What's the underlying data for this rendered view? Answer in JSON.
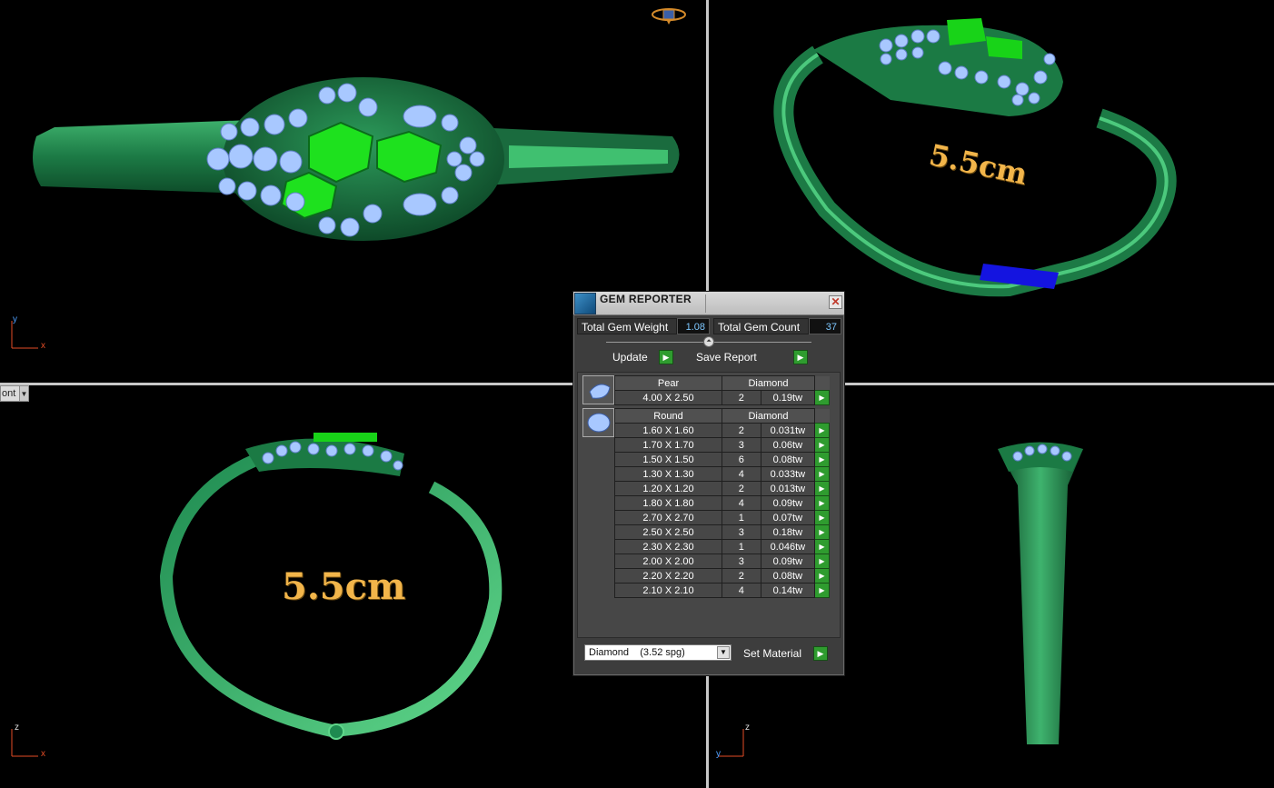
{
  "panel": {
    "title": "GEM REPORTER",
    "close": "✕",
    "total_weight_label": "Total Gem Weight",
    "total_weight_value": "1.08",
    "total_count_label": "Total Gem Count",
    "total_count_value": "37",
    "update_label": "Update",
    "save_report_label": "Save Report",
    "groups": [
      {
        "shape": "Pear",
        "material": "Diamond",
        "rows": [
          {
            "size": "4.00 X 2.50",
            "qty": "2",
            "weight": "0.19tw"
          }
        ]
      },
      {
        "shape": "Round",
        "material": "Diamond",
        "rows": [
          {
            "size": "1.60 X 1.60",
            "qty": "2",
            "weight": "0.031tw"
          },
          {
            "size": "1.70 X 1.70",
            "qty": "3",
            "weight": "0.06tw"
          },
          {
            "size": "1.50 X 1.50",
            "qty": "6",
            "weight": "0.08tw"
          },
          {
            "size": "1.30 X 1.30",
            "qty": "4",
            "weight": "0.033tw"
          },
          {
            "size": "1.20 X 1.20",
            "qty": "2",
            "weight": "0.013tw"
          },
          {
            "size": "1.80 X 1.80",
            "qty": "4",
            "weight": "0.09tw"
          },
          {
            "size": "2.70 X 2.70",
            "qty": "1",
            "weight": "0.07tw"
          },
          {
            "size": "2.50 X 2.50",
            "qty": "3",
            "weight": "0.18tw"
          },
          {
            "size": "2.30 X 2.30",
            "qty": "1",
            "weight": "0.046tw"
          },
          {
            "size": "2.00 X 2.00",
            "qty": "3",
            "weight": "0.09tw"
          },
          {
            "size": "2.20 X 2.20",
            "qty": "2",
            "weight": "0.08tw"
          },
          {
            "size": "2.10 X 2.10",
            "qty": "4",
            "weight": "0.14tw"
          }
        ]
      }
    ],
    "material_select": "Diamond    (3.52 spg)",
    "set_material_label": "Set Material"
  },
  "viewports": {
    "top_right_measure": "5.5cm",
    "bottom_left_measure": "5.5cm",
    "view_dropdown": "ont",
    "axes": {
      "top_left": {
        "v": "y",
        "h": "x"
      },
      "bottom_left": {
        "v": "z",
        "h": "x"
      },
      "bottom_right": {
        "v": "z",
        "h": "y"
      }
    }
  },
  "colors": {
    "band": "#1f8a4e",
    "band_light": "#5fd68a",
    "enamel": "#18d318",
    "gem": "#9fc4ff",
    "measure": "#f2b54a",
    "accent_go": "#2f9c2f"
  }
}
